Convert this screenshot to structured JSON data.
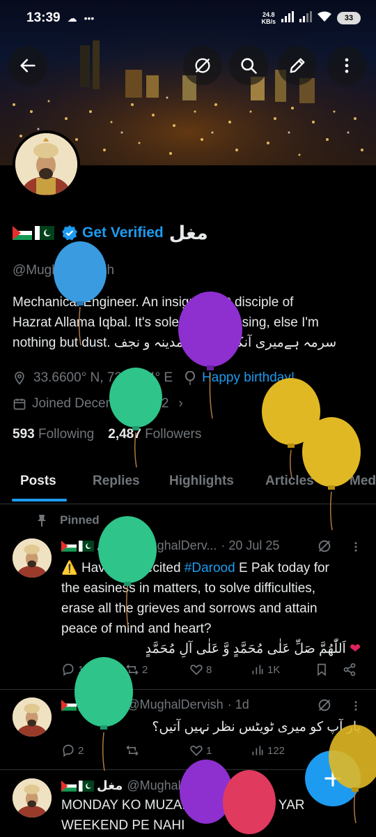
{
  "status_bar": {
    "time": "13:39",
    "speed_value": "24.8",
    "speed_unit": "KB/s",
    "battery": "33"
  },
  "top_actions": {
    "back_icon": "arrow-left-icon",
    "grok_icon": "grok-icon",
    "search_icon": "search-icon",
    "edit_icon": "edit-pencil-icon",
    "more_icon": "more-vertical-icon"
  },
  "profile": {
    "get_verified": "Get Verified",
    "display_name": "مغل",
    "handle": "@MughalDervish",
    "bio_lines": [
      "Mechanical Engineer. An insignificant disciple of",
      "Hazrat Allama Iqbal. It's solely Thy blessing, else I'm",
      "nothing but dust. سرمہ ہےمیری آنکھ کا خاک مدینہ و نجف"
    ],
    "location": "33.6600° N, 73.2294° E",
    "birthday": "Happy birthday!",
    "joined": "Joined December 2012",
    "following_count": "593",
    "following_label": "Following",
    "followers_count": "2,487",
    "followers_label": "Followers"
  },
  "tabs": [
    "Posts",
    "Replies",
    "Highlights",
    "Articles",
    "Media"
  ],
  "pinned_label": "Pinned",
  "tweets": [
    {
      "name": "مغل",
      "handle": "@MughalDerv...",
      "time": "· 20 Jul 25",
      "lines": [
        "Have you recited ",
        "#Darood",
        " E Pak today for",
        "the easiness in matters, to solve difficulties,",
        "erase all the grieves and sorrows and attain",
        "peace of mind and heart?",
        "اَللّٰھُمَّ صَلِّ عَلٰی مُحَمَّدٍ وَّ عَلٰی آلِ مُحَمَّدٍ"
      ],
      "replies": "1",
      "reposts": "2",
      "likes": "8",
      "views": "1K"
    },
    {
      "name": "مغل",
      "handle": "@MughalDervish",
      "time": "· 1d",
      "lines": [
        "یار آپ کو میری ٹویٹس نظر نہیں آتیں؟"
      ],
      "replies": "2",
      "reposts": "",
      "likes": "1",
      "views": "122"
    },
    {
      "name": "مغل",
      "handle": "@MughalDervish",
      "time": "· 1d",
      "lines": [
        "MONDAY KO MUZAKRAAT KARAO YAR",
        "WEEKEND PE NAHI"
      ]
    }
  ],
  "colors": {
    "accent": "#1d9bf0",
    "muted": "#71767b",
    "background": "#000000"
  }
}
